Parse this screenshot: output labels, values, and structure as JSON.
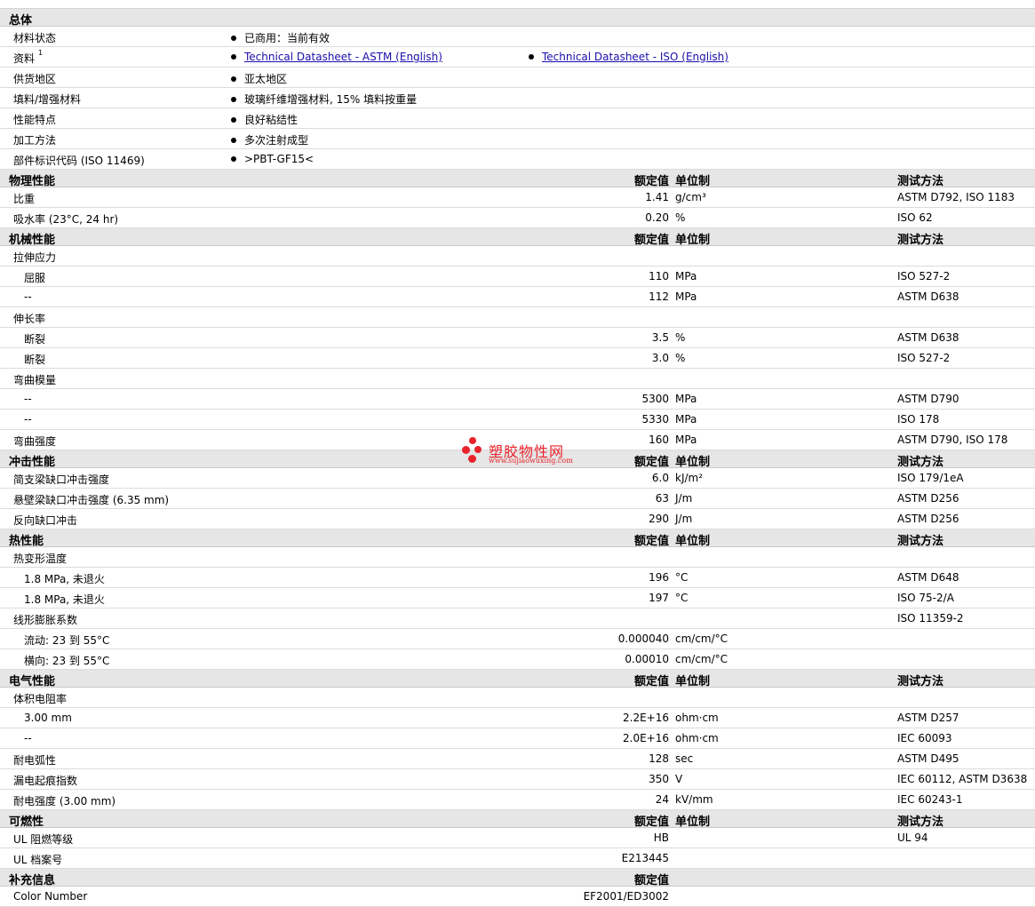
{
  "general": {
    "title": "总体",
    "rows": [
      {
        "label": "材料状态",
        "bullets": [
          "已商用：当前有效"
        ]
      },
      {
        "label": "资料",
        "sup": "1",
        "links": [
          "Technical Datasheet - ASTM (English)",
          "Technical Datasheet - ISO (English)"
        ]
      },
      {
        "label": "供货地区",
        "bullets": [
          "亚太地区"
        ]
      },
      {
        "label": "填料/增强材料",
        "bullets": [
          "玻璃纤维增强材料, 15% 填料按重量"
        ]
      },
      {
        "label": "性能特点",
        "bullets": [
          "良好粘结性"
        ]
      },
      {
        "label": "加工方法",
        "bullets": [
          "多次注射成型"
        ]
      },
      {
        "label": "部件标识代码 (ISO 11469)",
        "bullets": [
          ">PBT-GF15<"
        ]
      }
    ]
  },
  "columns": {
    "value": "额定值",
    "unit": "单位制",
    "test": "测试方法"
  },
  "sections": [
    {
      "title": "物理性能",
      "rows": [
        {
          "label": "比重",
          "value": "1.41",
          "unit": "g/cm³",
          "test": "ASTM D792, ISO 1183"
        },
        {
          "label": "吸水率 (23°C, 24 hr)",
          "value": "0.20",
          "unit": "%",
          "test": "ISO 62"
        }
      ]
    },
    {
      "title": "机械性能",
      "rows": [
        {
          "label": "拉伸应力"
        },
        {
          "label": "屈服",
          "sub": true,
          "value": "110",
          "unit": "MPa",
          "test": "ISO 527-2"
        },
        {
          "label": "--",
          "sub": true,
          "value": "112",
          "unit": "MPa",
          "test": "ASTM D638"
        },
        {
          "label": "伸长率"
        },
        {
          "label": "断裂",
          "sub": true,
          "value": "3.5",
          "unit": "%",
          "test": "ASTM D638"
        },
        {
          "label": "断裂",
          "sub": true,
          "value": "3.0",
          "unit": "%",
          "test": "ISO 527-2"
        },
        {
          "label": "弯曲模量"
        },
        {
          "label": "--",
          "sub": true,
          "value": "5300",
          "unit": "MPa",
          "test": "ASTM D790"
        },
        {
          "label": "--",
          "sub": true,
          "value": "5330",
          "unit": "MPa",
          "test": "ISO 178"
        },
        {
          "label": "弯曲强度",
          "value": "160",
          "unit": "MPa",
          "test": "ASTM D790, ISO 178"
        }
      ]
    },
    {
      "title": "冲击性能",
      "rows": [
        {
          "label": "简支梁缺口冲击强度",
          "value": "6.0",
          "unit": "kJ/m²",
          "test": "ISO 179/1eA"
        },
        {
          "label": "悬壁梁缺口冲击强度 (6.35 mm)",
          "value": "63",
          "unit": "J/m",
          "test": "ASTM D256"
        },
        {
          "label": "反向缺口冲击",
          "value": "290",
          "unit": "J/m",
          "test": "ASTM D256"
        }
      ]
    },
    {
      "title": "热性能",
      "rows": [
        {
          "label": "热变形温度"
        },
        {
          "label": "1.8 MPa, 未退火",
          "sub": true,
          "value": "196",
          "unit": "°C",
          "test": "ASTM D648"
        },
        {
          "label": "1.8 MPa, 未退火",
          "sub": true,
          "value": "197",
          "unit": "°C",
          "test": "ISO 75-2/A"
        },
        {
          "label": "线形膨胀系数",
          "test": "ISO 11359-2"
        },
        {
          "label": "流动: 23 到 55°C",
          "sub": true,
          "value": "0.000040",
          "unit": "cm/cm/°C"
        },
        {
          "label": "横向: 23 到 55°C",
          "sub": true,
          "value": "0.00010",
          "unit": "cm/cm/°C"
        }
      ]
    },
    {
      "title": "电气性能",
      "rows": [
        {
          "label": "体积电阻率"
        },
        {
          "label": "3.00 mm",
          "sub": true,
          "value": "2.2E+16",
          "unit": "ohm·cm",
          "test": "ASTM D257"
        },
        {
          "label": "--",
          "sub": true,
          "value": "2.0E+16",
          "unit": "ohm·cm",
          "test": "IEC 60093"
        },
        {
          "label": "耐电弧性",
          "value": "128",
          "unit": "sec",
          "test": "ASTM D495"
        },
        {
          "label": "漏电起痕指数",
          "value": "350",
          "unit": "V",
          "test": "IEC 60112, ASTM D3638"
        },
        {
          "label": "耐电强度 (3.00 mm)",
          "value": "24",
          "unit": "kV/mm",
          "test": "IEC 60243-1"
        }
      ]
    },
    {
      "title": "可燃性",
      "rows": [
        {
          "label": "UL 阻燃等级",
          "value": "HB",
          "test": "UL 94"
        },
        {
          "label": "UL 档案号",
          "value": "E213445"
        }
      ]
    },
    {
      "title": "补充信息",
      "valueOnly": true,
      "rows": [
        {
          "label": "Color Number",
          "value": "EF2001/ED3002"
        }
      ]
    }
  ],
  "watermark": {
    "title": "塑胶物性网",
    "url": "www.sujiaowuxing.com",
    "color": "#e8232b"
  }
}
